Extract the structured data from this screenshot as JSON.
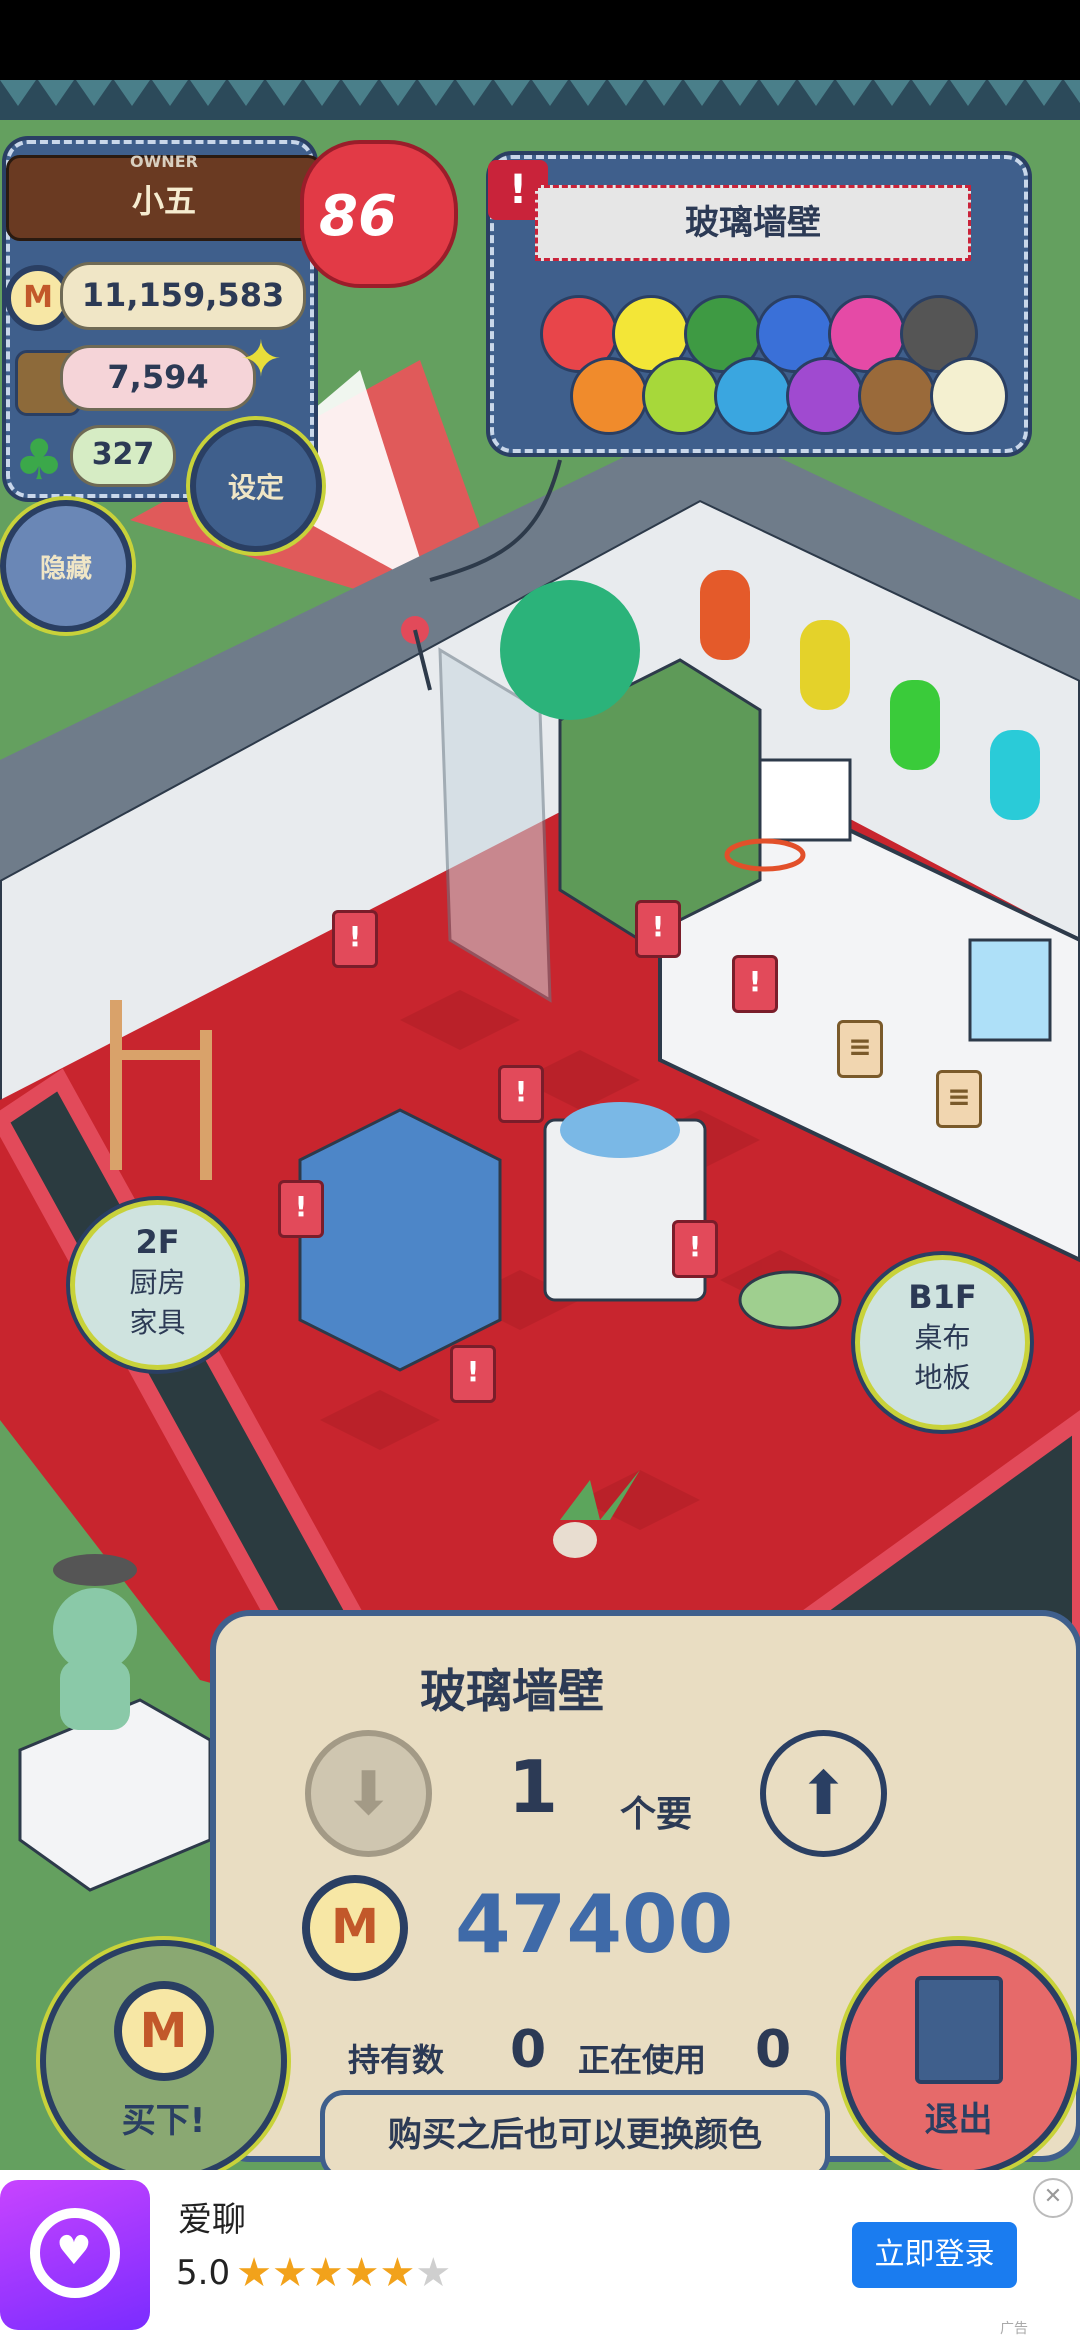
{
  "hud": {
    "owner_label": "OWNER",
    "owner_name": "小五",
    "level": "86",
    "coins": "11,159,583",
    "points": "7,594",
    "clovers": "327",
    "settings_label": "设定",
    "hide_label": "隐藏"
  },
  "item_panel": {
    "item_name": "玻璃墙壁",
    "colors": [
      "#e8454a",
      "#f3e637",
      "#3e9a43",
      "#3a70d8",
      "#e54aa6",
      "#555555",
      "#f08b2c",
      "#a7d83a",
      "#3aa6e0",
      "#a04ad0",
      "#9a6a3a",
      "#f4f0d0"
    ]
  },
  "floor_labels": {
    "left": {
      "floor": "2F",
      "line1": "厨房",
      "line2": "家具"
    },
    "right": {
      "floor": "B1F",
      "line1": "桌布",
      "line2": "地板"
    }
  },
  "purchase": {
    "title": "玻璃墙壁",
    "quantity": "1",
    "quantity_unit": "个要",
    "price": "47400",
    "owned_label": "持有数",
    "owned_value": "0",
    "in_use_label": "正在使用",
    "in_use_value": "0",
    "note": "购买之后也可以更换颜色",
    "buy_label": "买下!",
    "exit_label": "退出"
  },
  "ad": {
    "app_name": "爱聊",
    "rating": "5.0",
    "stars_filled": 5,
    "login_button": "立即登录",
    "ad_tag": "广告"
  }
}
